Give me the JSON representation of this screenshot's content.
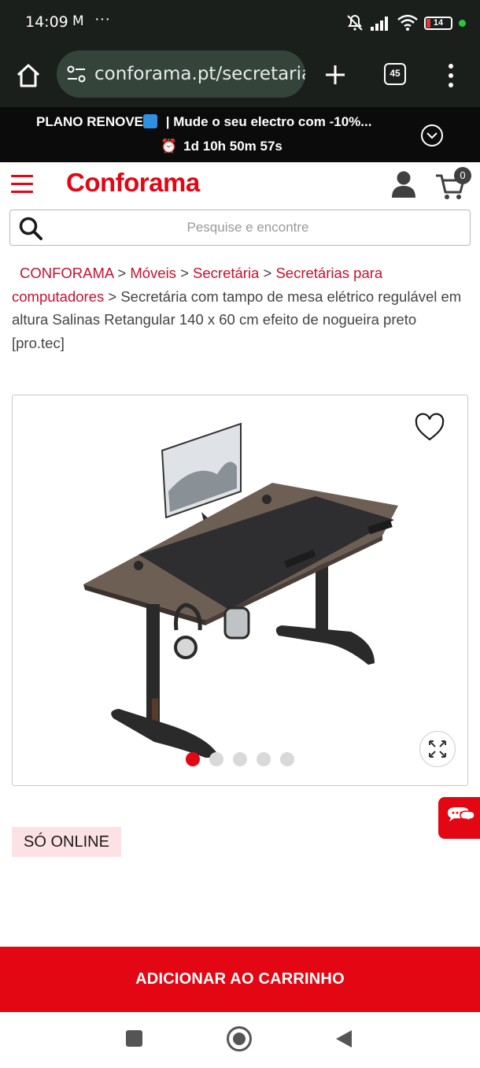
{
  "status_bar": {
    "time": "14:09",
    "mail_icon": "gmail-icon",
    "more": "···",
    "battery": "14"
  },
  "browser": {
    "url": "conforama.pt/secretaria",
    "tab_count": "45"
  },
  "promo": {
    "line1": "PLANO RENOVE🔄 | Mude o seu electro com -10%...",
    "line1_text": "PLANO RENOVE",
    "line1_rest": " | Mude o seu electro com -10%...",
    "countdown": "1d 10h 50m 57s"
  },
  "header": {
    "logo": "Conforama",
    "cart_count": "0"
  },
  "search": {
    "placeholder": "Pesquise e encontre"
  },
  "breadcrumb": {
    "items": [
      "CONFORAMA",
      "Móveis",
      "Secretária",
      "Secretárias para computadores"
    ],
    "separator": " > ",
    "current": "Secretária com tampo de mesa elétrico regulável em altura Salinas Retangular 140 x 60 cm efeito de nogueira preto [pro.tec]"
  },
  "gallery": {
    "image_count": 5,
    "active_index": 0
  },
  "badge": {
    "label": "SÓ ONLINE"
  },
  "cta": {
    "add_to_cart": "ADICIONAR AO CARRINHO"
  },
  "colors": {
    "brand_red": "#e30613",
    "badge_bg": "#fde1e4",
    "dark_bar": "#1a1f1c"
  }
}
